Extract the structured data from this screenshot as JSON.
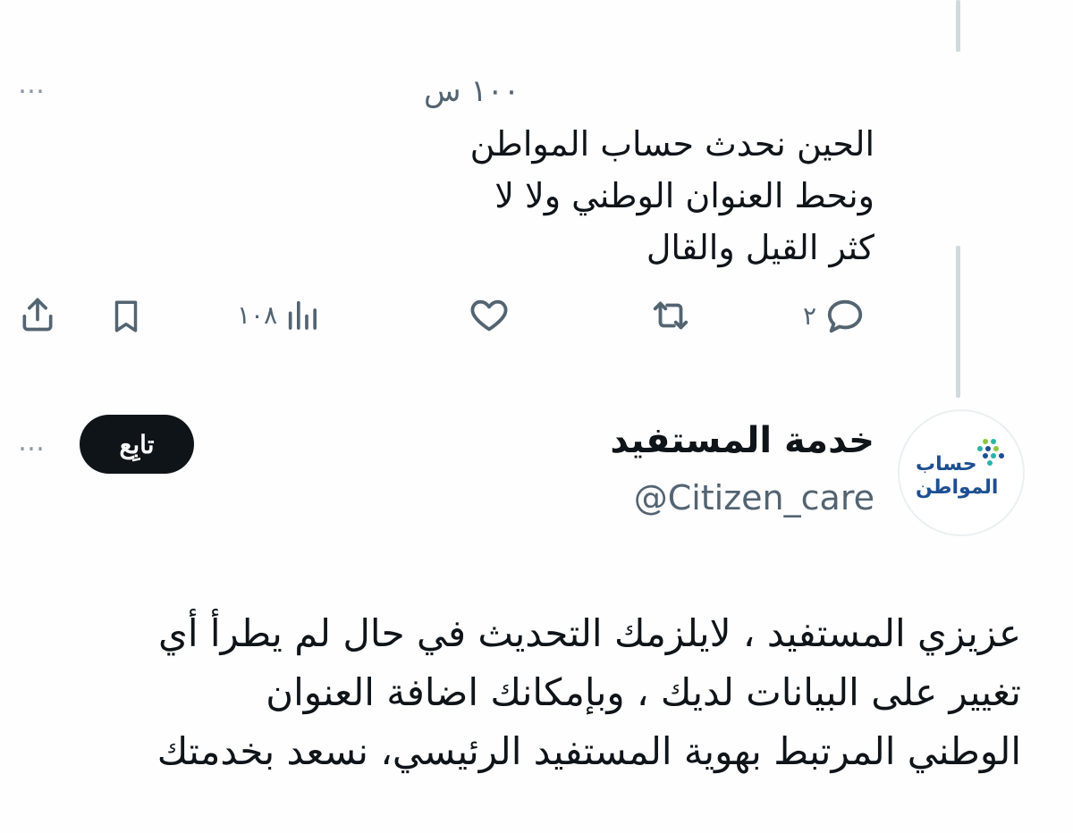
{
  "tweet": {
    "time": "١٠٠ س",
    "lines": [
      "الحين نحدث حساب المواطن",
      "ونحط العنوان الوطني ولا لا",
      "كثر القيل والقال"
    ],
    "more_icon": "…",
    "actions": {
      "reply_count": "٢",
      "views_count": "١٠٨"
    }
  },
  "reply": {
    "display_name": "خدمة المستفيد",
    "handle": "@Citizen_care",
    "follow_label": "تابِع",
    "avatar_logo": {
      "line1": "حساب",
      "line2": "المواطن"
    },
    "lines": [
      "عزيزي المستفيد ، لايلزمك التحديث في حال لم يطرأ أي",
      "تغيير على البيانات لديك ، وبإمكانك اضافة العنوان",
      "الوطني المرتبط بهوية المستفيد الرئيسي، نسعد بخدمتك"
    ],
    "more_icon": "…"
  },
  "colors": {
    "text": "#0f1419",
    "secondary": "#536471",
    "thread_line": "#cfd9de",
    "logo_dark_blue": "#1d4f91",
    "logo_teal": "#2bb3a9",
    "logo_green": "#8cc63f"
  }
}
